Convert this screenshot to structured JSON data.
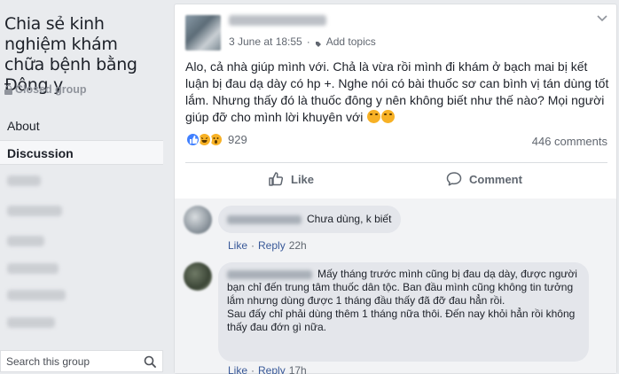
{
  "sidebar": {
    "group_name": "Chia sẻ kinh nghiệm khám chữa bệnh bằng Đông y",
    "group_type": "Closed group",
    "nav_about": "About",
    "nav_discussion": "Discussion",
    "search_placeholder": "Search this group"
  },
  "post": {
    "date": "3 June at 18:55",
    "separator": "·",
    "add_topics": "Add topics",
    "text": "Alo, cả nhà giúp mình với. Chả là vừa rồi mình đi khám ở bạch mai bị kết luận bị đau dạ dày có hp +. Nghe nói có bài thuốc sơ can bình vị tán dùng tốt lắm. Nhưng thấy đó là thuốc đông y nên không biết như thế nào? Mọi người giúp đỡ cho mình lời khuyên với",
    "reaction_count": "929",
    "comments_count": "446 comments",
    "like_label": "Like",
    "comment_label": "Comment"
  },
  "comments": [
    {
      "text": "Chưa dùng, k biết",
      "like": "Like",
      "reply": "Reply",
      "separator": "·",
      "time": "22h"
    },
    {
      "text_1": "Mấy tháng trước mình cũng bị đau dạ dày, được người bạn chỉ đến trung tâm thuốc dân tộc. Ban đầu mình cũng không tin tưởng lắm nhưng dùng được 1 tháng đầu thấy đã đỡ đau hẳn rồi.",
      "text_2": "Sau đấy chỉ phải dùng thêm 1 tháng nữa thôi. Đến nay khỏi hẳn rồi không thấy đau đớn gì nữa.",
      "like": "Like",
      "reply": "Reply",
      "separator": "·",
      "time": "17h"
    }
  ],
  "colors": {
    "link": "#385898",
    "like_reaction": "#4080ff",
    "emoji": "#f7b125",
    "background": "#e9ebee"
  },
  "icons": [
    "lock-icon",
    "add-topics-icon",
    "caret-down-icon",
    "thumbs-up-icon",
    "comment-icon",
    "search-icon",
    "crying-emoji-icon"
  ]
}
